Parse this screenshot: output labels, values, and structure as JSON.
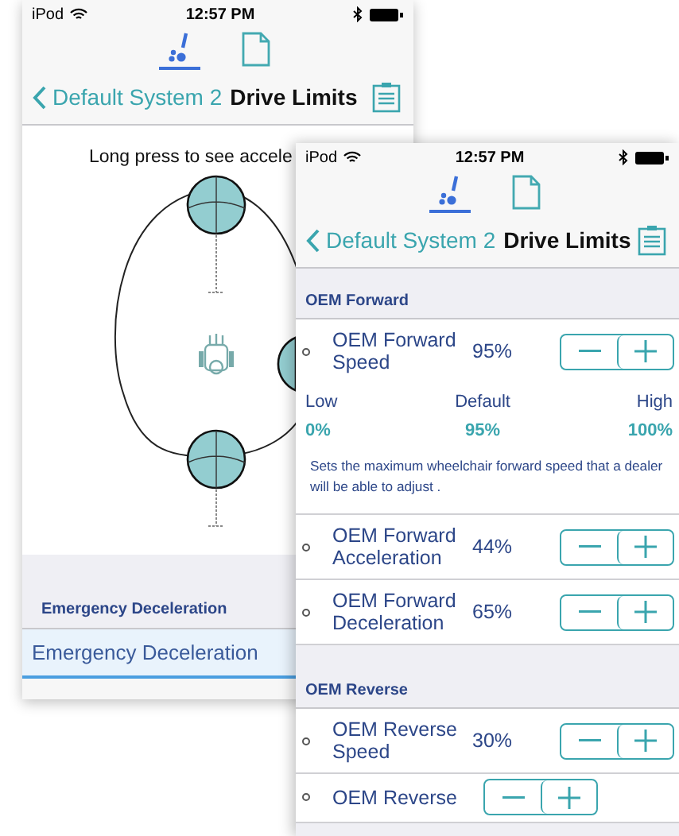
{
  "back_screen": {
    "status_bar": {
      "carrier": "iPod",
      "time": "12:57 PM"
    },
    "tabs": [
      {
        "kind": "wheelchair",
        "selected": true
      },
      {
        "kind": "document",
        "selected": false
      }
    ],
    "nav": {
      "back": "Default System 2",
      "title": "Drive Limits"
    },
    "hint": "Long press to see accele",
    "section": {
      "title": "Emergency Deceleration"
    },
    "rows": [
      {
        "label": "Emergency Deceleration",
        "selected": true
      }
    ]
  },
  "front_screen": {
    "status_bar": {
      "carrier": "iPod",
      "time": "12:57 PM"
    },
    "tabs": [
      {
        "kind": "wheelchair",
        "selected": true
      },
      {
        "kind": "document",
        "selected": false
      }
    ],
    "nav": {
      "back": "Default System 2",
      "title": "Drive Limits"
    },
    "sections": [
      {
        "title": "OEM Forward",
        "items": [
          {
            "label": "OEM Forward Speed",
            "value": "95%",
            "expanded": true,
            "range": [
              {
                "label": "Low",
                "value": "0%"
              },
              {
                "label": "Default",
                "value": "95%"
              },
              {
                "label": "High",
                "value": "100%"
              }
            ],
            "description": "Sets the maximum wheelchair forward speed that a dealer will be able to adjust ."
          },
          {
            "label": "OEM Forward Acceleration",
            "value": "44%",
            "expanded": false
          },
          {
            "label": "OEM Forward Deceleration",
            "value": "65%",
            "expanded": false
          }
        ]
      },
      {
        "title": "OEM Reverse",
        "items": [
          {
            "label": "OEM Reverse Speed",
            "value": "30%",
            "expanded": false
          },
          {
            "label": "OEM Reverse",
            "expanded": false
          }
        ]
      }
    ]
  }
}
